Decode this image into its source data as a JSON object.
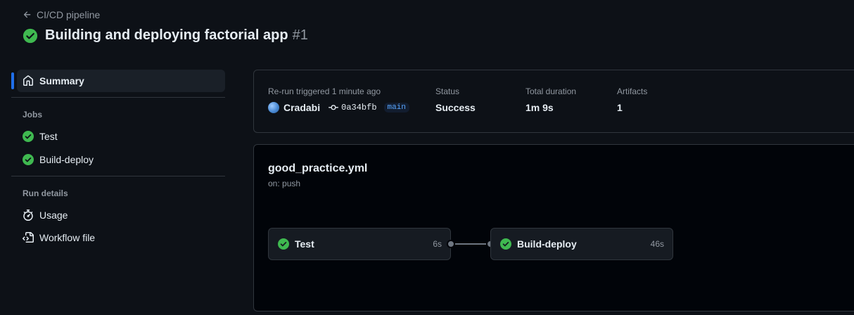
{
  "header": {
    "back_label": "CI/CD pipeline",
    "title": "Building and deploying factorial app",
    "run_number": "#1",
    "status_icon": "check-circle-fill-icon",
    "success_color": "#3fb950"
  },
  "sidebar": {
    "summary_label": "Summary",
    "jobs_heading": "Jobs",
    "jobs": [
      {
        "label": "Test",
        "status": "success"
      },
      {
        "label": "Build-deploy",
        "status": "success"
      }
    ],
    "run_details_heading": "Run details",
    "usage_label": "Usage",
    "workflow_file_label": "Workflow file"
  },
  "summary": {
    "trigger_label": "Re-run triggered 1 minute ago",
    "user": "Cradabi",
    "commit": "0a34bfb",
    "branch": "main",
    "status_label": "Status",
    "status_value": "Success",
    "duration_label": "Total duration",
    "duration_value": "1m 9s",
    "artifacts_label": "Artifacts",
    "artifacts_value": "1"
  },
  "workflow": {
    "file_name": "good_practice.yml",
    "trigger": "on: push",
    "jobs": [
      {
        "name": "Test",
        "duration": "6s",
        "status": "success"
      },
      {
        "name": "Build-deploy",
        "duration": "46s",
        "status": "success"
      }
    ]
  },
  "colors": {
    "accent": "#1f6feb",
    "background": "#0d1117",
    "muted_text": "#9198a1"
  }
}
